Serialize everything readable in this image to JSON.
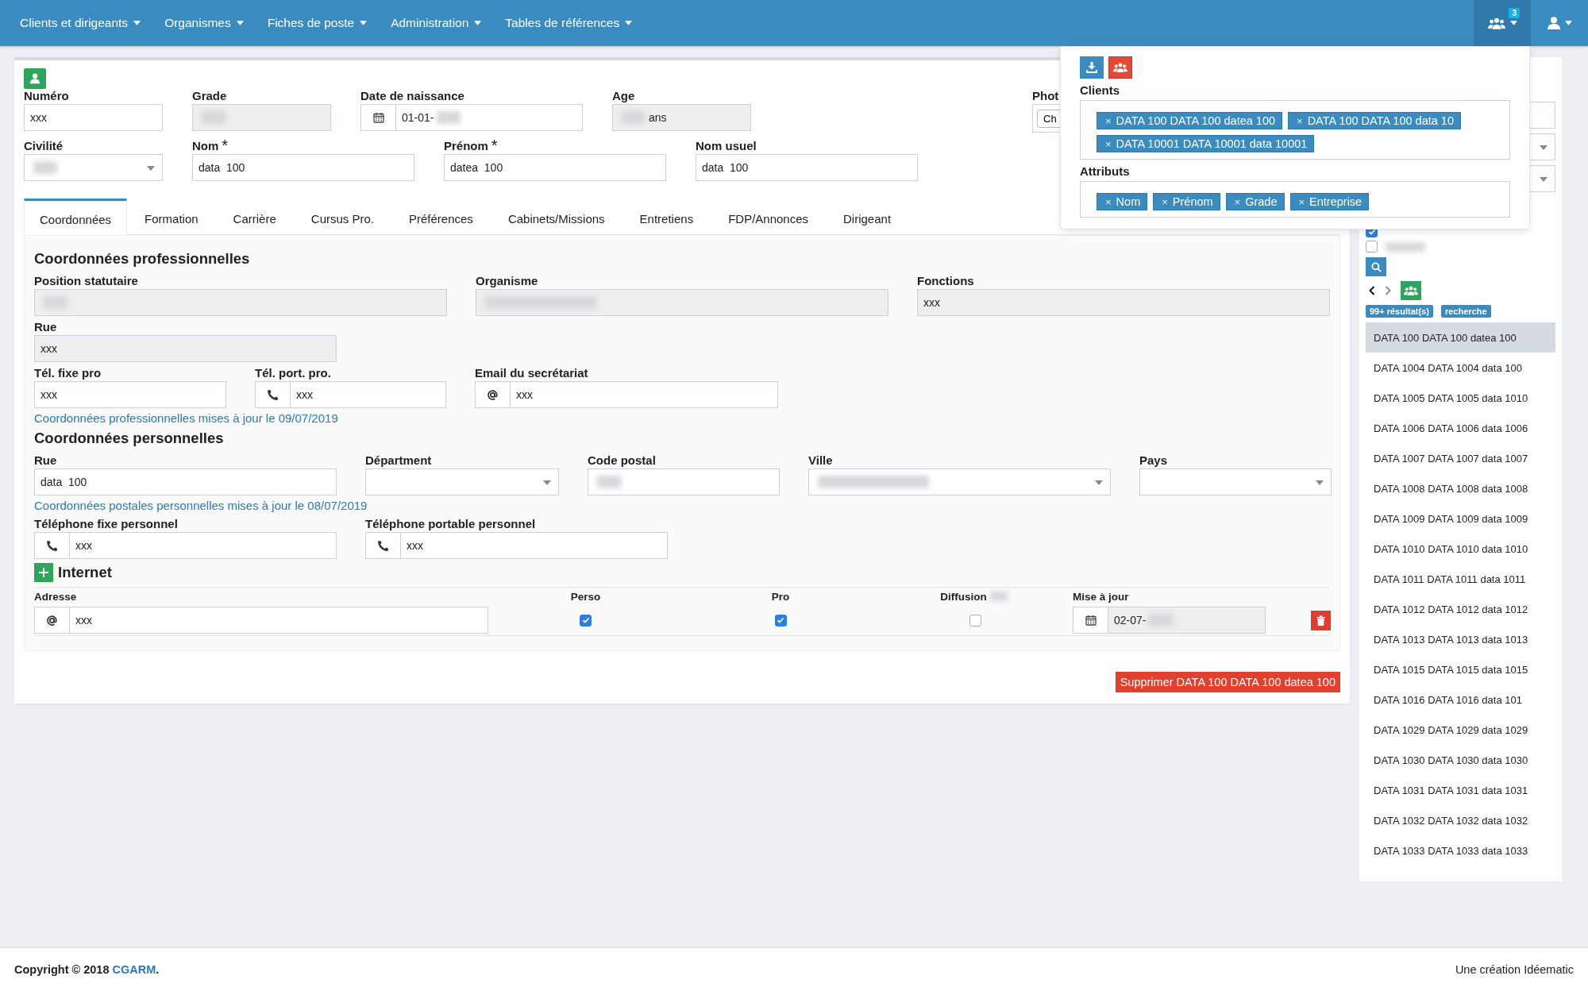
{
  "nav": {
    "menus": [
      "Clients et dirigeants",
      "Organismes",
      "Fiches de poste",
      "Administration",
      "Tables de références"
    ],
    "notification_count": "3"
  },
  "header": {
    "rows": [
      {
        "kind": "fields",
        "fields": [
          {
            "label": "Numéro",
            "kind": "text",
            "value": "xxx"
          },
          {
            "label": "Grade",
            "kind": "readonly",
            "blur_before": true
          },
          {
            "label": "Date de naissance",
            "kind": "date",
            "value": "01-01-",
            "blur_after": true
          },
          {
            "label": "Age",
            "kind": "readonly",
            "value": "ans",
            "blur_before": true
          },
          {
            "label": "Phot",
            "kind": "file",
            "button": "Ch"
          }
        ]
      },
      {
        "kind": "fields",
        "fields": [
          {
            "label": "Civilité",
            "kind": "select",
            "blur_before": true
          },
          {
            "label": "Nom",
            "kind": "text",
            "value": "data  100",
            "required_mark": "*"
          },
          {
            "label": "Prénom",
            "kind": "text",
            "value": "datea  100",
            "required_mark": "*"
          },
          {
            "label": "Nom usuel",
            "kind": "text",
            "value": "data  100"
          }
        ]
      }
    ]
  },
  "tabs": [
    {
      "label": "Coordonnées",
      "selected": true
    },
    {
      "label": "Formation",
      "selected": false
    },
    {
      "label": "Carrière",
      "selected": false
    },
    {
      "label": "Cursus Pro.",
      "selected": false
    },
    {
      "label": "Préférences",
      "selected": false
    },
    {
      "label": "Cabinets/Missions",
      "selected": false
    },
    {
      "label": "Entretiens",
      "selected": false
    },
    {
      "label": "FDP/Annonces",
      "selected": false
    },
    {
      "label": "Dirigeant",
      "selected": false
    }
  ],
  "professional": {
    "title": "Coordonnées professionnelles",
    "rows": [
      {
        "kind": "fields",
        "fields": [
          {
            "label": "Position statutaire",
            "kind": "readonly",
            "blur_before": true
          },
          {
            "label": "Organisme",
            "kind": "readonly",
            "blur_before": true
          },
          {
            "label": "Fonctions",
            "kind": "readonly",
            "value": "xxx"
          }
        ]
      },
      {
        "kind": "fields",
        "fields": [
          {
            "label": "Rue",
            "kind": "readonly",
            "value": "xxx"
          }
        ]
      },
      {
        "kind": "fields",
        "fields": [
          {
            "label": "Tél. fixe pro",
            "kind": "text",
            "value": "xxx"
          },
          {
            "label": "Tél. port. pro.",
            "kind": "phone",
            "value": "xxx"
          },
          {
            "label": "Email du secrétariat",
            "kind": "email",
            "value": "xxx"
          }
        ]
      },
      {
        "kind": "note",
        "text": "Coordonnées professionnelles mises à jour le 09/07/2019"
      }
    ]
  },
  "personal": {
    "title": "Coordonnées personnelles",
    "rows": [
      {
        "kind": "fields",
        "fields": [
          {
            "label": "Rue",
            "kind": "text",
            "value": "data  100"
          },
          {
            "label": "Départment",
            "kind": "select"
          },
          {
            "label": "Code postal",
            "kind": "text",
            "blur_before": true
          },
          {
            "label": "Ville",
            "kind": "select",
            "blur_before": true
          },
          {
            "label": "Pays",
            "kind": "select"
          }
        ]
      },
      {
        "kind": "note",
        "text": "Coordonnées postales personnelles mises à jour le 08/07/2019"
      },
      {
        "kind": "fields",
        "fields": [
          {
            "label": "Téléphone fixe personnel",
            "kind": "phone",
            "value": "xxx"
          },
          {
            "label": "Téléphone portable personnel",
            "kind": "phone",
            "value": "xxx"
          }
        ]
      }
    ]
  },
  "internet": {
    "title": "Internet",
    "columns": [
      "Adresse",
      "Perso",
      "Pro",
      "Diffusion",
      "Mise à jour"
    ],
    "rows": [
      {
        "address": "xxx",
        "perso": true,
        "pro": true,
        "diffusion": false,
        "updated": "02-07-"
      }
    ]
  },
  "delete_button": "Supprimer DATA 100 DATA 100 datea 100",
  "popup": {
    "clients_label": "Clients",
    "clients": [
      "DATA 100 DATA 100 datea 100",
      "DATA 100 DATA 100 data 10",
      "DATA 10001 DATA 10001 data 10001"
    ],
    "attributes_label": "Attributs",
    "attributes": [
      "Nom",
      "Prénom",
      "Grade",
      "Entreprise"
    ],
    "tag_remove": "×"
  },
  "sidebar": {
    "checkboxes": [
      {
        "checked": true
      },
      {
        "checked": false
      }
    ],
    "results_badge": "99+ résultat(s)",
    "search_badge": "recherche",
    "items": [
      {
        "label": "DATA 100 DATA 100 datea 100",
        "selected": true
      },
      {
        "label": "DATA 1004 DATA 1004 data 100",
        "selected": false
      },
      {
        "label": "DATA 1005 DATA 1005 data 1010",
        "selected": false
      },
      {
        "label": "DATA 1006 DATA 1006 data 1006",
        "selected": false
      },
      {
        "label": "DATA 1007 DATA 1007 data 1007",
        "selected": false
      },
      {
        "label": "DATA 1008 DATA 1008 data 1008",
        "selected": false
      },
      {
        "label": "DATA 1009 DATA 1009 data 1009",
        "selected": false
      },
      {
        "label": "DATA 1010 DATA 1010 data 1010",
        "selected": false
      },
      {
        "label": "DATA 1011 DATA 1011 data 1011",
        "selected": false
      },
      {
        "label": "DATA 1012 DATA 1012 data 1012",
        "selected": false
      },
      {
        "label": "DATA 1013 DATA 1013 data 1013",
        "selected": false
      },
      {
        "label": "DATA 1015 DATA 1015 data 1015",
        "selected": false
      },
      {
        "label": "DATA 1016 DATA 1016 data 101",
        "selected": false
      },
      {
        "label": "DATA 1029 DATA 1029 data 1029",
        "selected": false
      },
      {
        "label": "DATA 1030 DATA 1030 data 1030",
        "selected": false
      },
      {
        "label": "DATA 1031 DATA 1031 data 1031",
        "selected": false
      },
      {
        "label": "DATA 1032 DATA 1032 data 1032",
        "selected": false
      },
      {
        "label": "DATA 1033 DATA 1033 data 1033",
        "selected": false
      }
    ]
  },
  "footer": {
    "copyright": "Copyright © 2018 ",
    "brand": "CGARM",
    "suffix": ".",
    "credit": "Une création Idéematic"
  }
}
